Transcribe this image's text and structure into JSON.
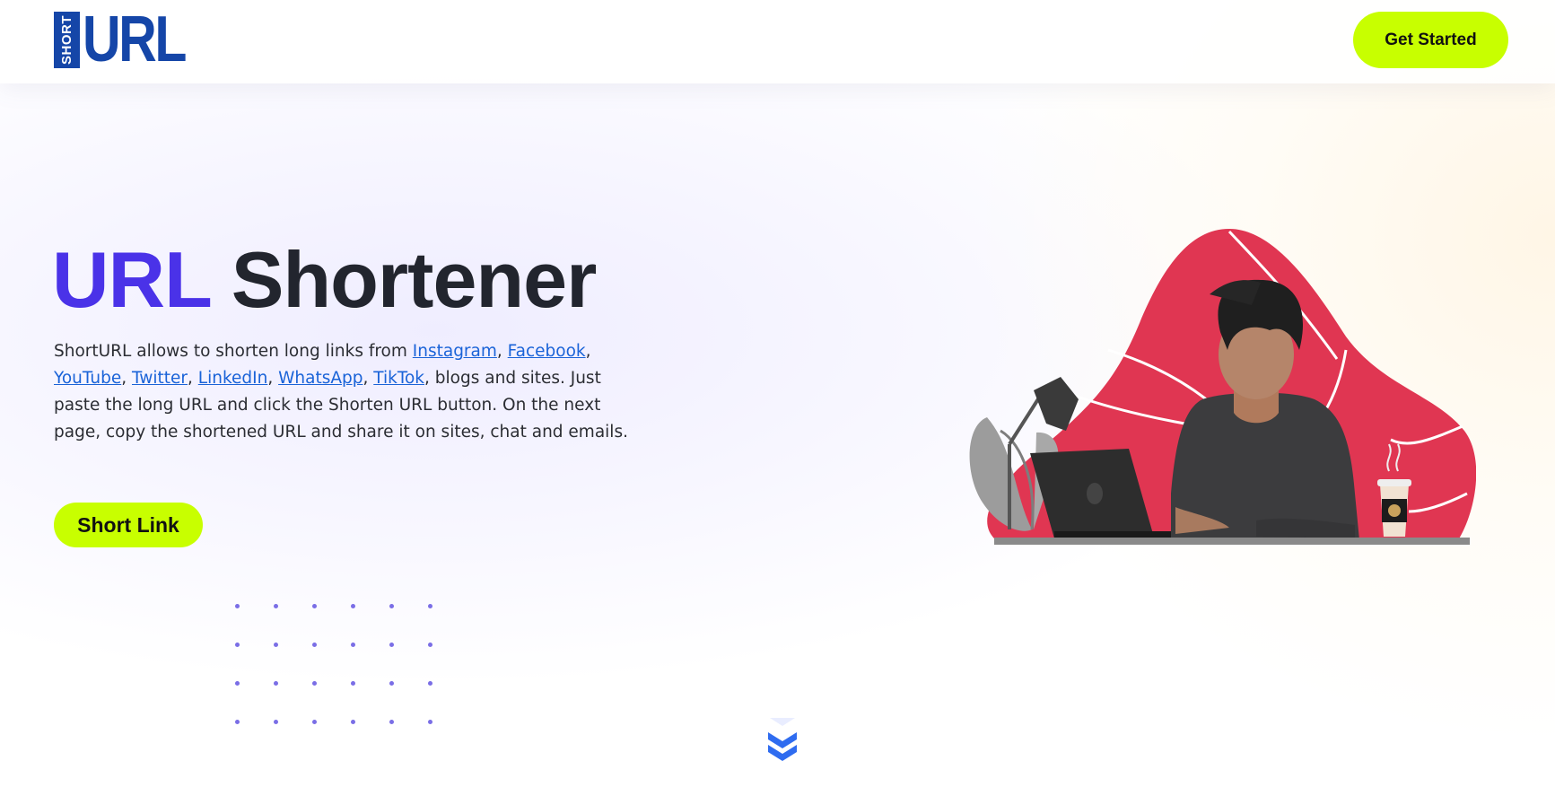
{
  "header": {
    "logo": {
      "short_text": "SHORT",
      "url_text": "URL"
    },
    "cta_label": "Get Started"
  },
  "hero": {
    "title_accent": "URL",
    "title_rest": "Shortener",
    "description": {
      "intro": "ShortURL allows to shorten long links from ",
      "links": [
        "Instagram",
        "Facebook",
        "YouTube",
        "Twitter",
        "LinkedIn",
        "WhatsApp",
        "TikTok"
      ],
      "outro": ", blogs and sites. Just paste the long URL and click the Shorten URL button. On the next page, copy the shortened URL and share it on sites, chat and emails."
    },
    "button_label": "Short Link"
  },
  "icons": {
    "scroll": "chevrons-down-icon",
    "illustration": "man-working-on-laptop-illustration"
  },
  "colors": {
    "brand_blue": "#1546a8",
    "accent_purple": "#4a32e8",
    "button_lime": "#c8ff00",
    "link_blue": "#1a63d8",
    "blob_red": "#e03652",
    "dot_purple": "#7a6ee6"
  }
}
